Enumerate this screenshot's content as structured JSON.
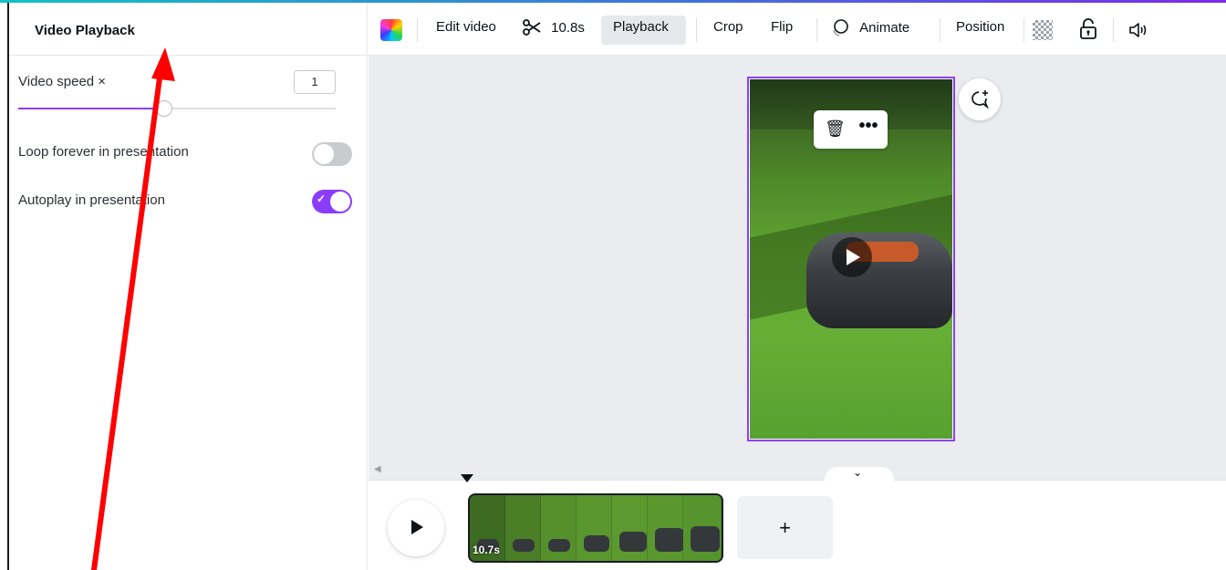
{
  "panel": {
    "title": "Video Playback",
    "speed_label": "Video speed ×",
    "speed_value": "1",
    "speed_slider_fraction": 0.43,
    "loop_label": "Loop forever in presentation",
    "loop_on": false,
    "autoplay_label": "Autoplay in presentation",
    "autoplay_on": true
  },
  "toolbar": {
    "edit_video": "Edit video",
    "trim_duration": "10.8s",
    "playback": "Playback",
    "crop": "Crop",
    "flip": "Flip",
    "animate": "Animate",
    "position": "Position"
  },
  "timeline": {
    "clip_duration": "10.7s",
    "add_label": "+"
  },
  "icons": {
    "color": "color-swatch-icon",
    "trim": "scissors-icon",
    "animate": "animate-icon",
    "transparency": "transparency-icon",
    "lock": "lock-icon",
    "volume": "volume-icon",
    "delete": "trash-icon",
    "more": "more-icon",
    "comment": "add-comment-icon"
  },
  "colors": {
    "accent": "#8b3dff",
    "annotation_arrow": "#ff0000"
  }
}
